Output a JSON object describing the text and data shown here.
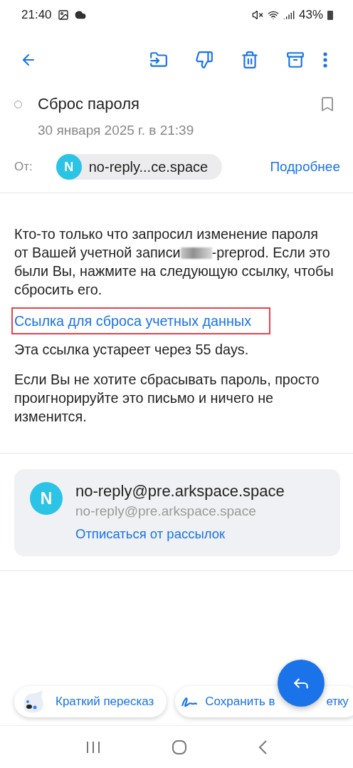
{
  "status_bar": {
    "time": "21:40",
    "battery": "43%"
  },
  "subject": {
    "title": "Сброс пароля",
    "read": false,
    "flagged": false
  },
  "date": "30 января 2025 г. в 21:39",
  "from": {
    "label": "От:",
    "avatar": "N",
    "name": "no-reply...ce.space",
    "details": "Подробнее"
  },
  "body": {
    "intro_line": "Кто-то только что запросил изменение пароля",
    "intro_start": "от Вашей учетной записи",
    "redacted": true,
    "intro_end": "-preprod. Если это",
    "intro_rest": "были Вы, нажмите на следующую ссылку, чтобы сбросить его.",
    "link": "Ссылка для сброса учетных данных",
    "link_highlighted": true,
    "expiry": "Эта ссылка устареет через 55 days.",
    "outro": "Если Вы не хотите сбрасывать пароль, просто проигнорируйте это письмо и ничего не изменится."
  },
  "sender_card": {
    "avatar": "N",
    "name": "no-reply@pre.arkspace.space",
    "email": "no-reply@pre.arkspace.space",
    "unsubscribe": "Отписаться от рассылок"
  },
  "chips": [
    {
      "kind": "summary",
      "label": "Краткий пересказ"
    },
    {
      "kind": "note",
      "label": "Сохранить в",
      "label_end": "етку"
    }
  ]
}
